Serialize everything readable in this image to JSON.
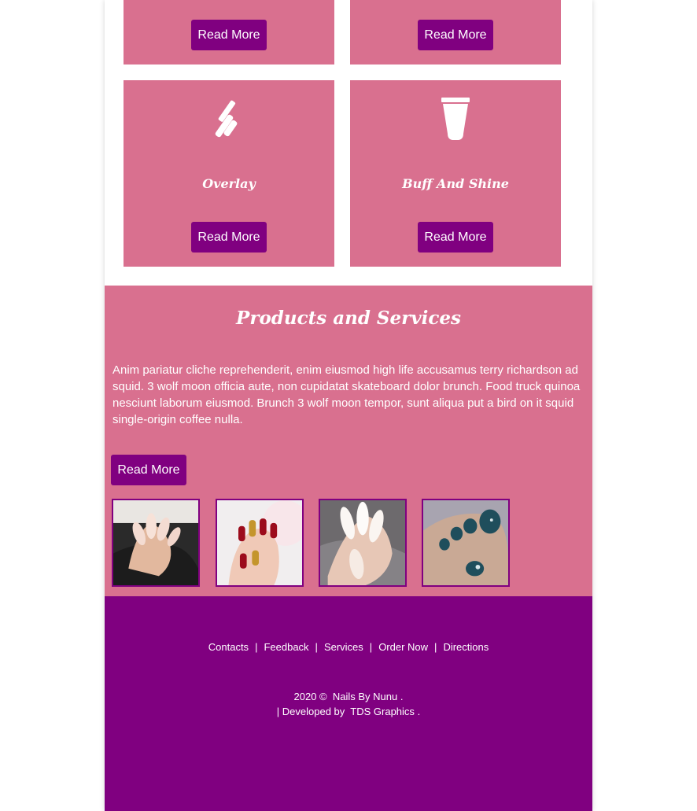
{
  "service_cards": [
    {
      "title": "",
      "button": "Read More"
    },
    {
      "title": "",
      "button": "Read More"
    },
    {
      "title": "Overlay",
      "icon": "mascara-brush-icon",
      "button": "Read More"
    },
    {
      "title": "Buff And Shine",
      "icon": "cream-tube-icon",
      "button": "Read More"
    }
  ],
  "products": {
    "heading": "Products and Services",
    "body": "Anim pariatur cliche reprehenderit, enim eiusmod high life accusamus terry richardson ad squid. 3 wolf moon officia aute, non cupidatat skateboard dolor brunch. Food truck quinoa nesciunt laborum eiusmod. Brunch 3 wolf moon tempor, sunt aliqua put a bird on it squid single-origin coffee nulla.",
    "button": "Read More",
    "gallery": [
      "nude-ombre-nails-photo",
      "red-gold-nails-photo",
      "white-ombre-nails-photo",
      "teal-toenails-photo"
    ]
  },
  "footer": {
    "links": [
      "Contacts",
      "Feedback",
      "Services",
      "Order Now",
      "Directions"
    ],
    "separator": "|",
    "copyright_prefix": "2020 ©",
    "brand": "Nails By Nunu",
    "brand_suffix": ".",
    "developed_prefix": "| Developed by",
    "developer": "TDS Graphics",
    "developer_suffix": "."
  },
  "colors": {
    "pink": "#d9708f",
    "purple": "#800080",
    "white": "#ffffff"
  }
}
